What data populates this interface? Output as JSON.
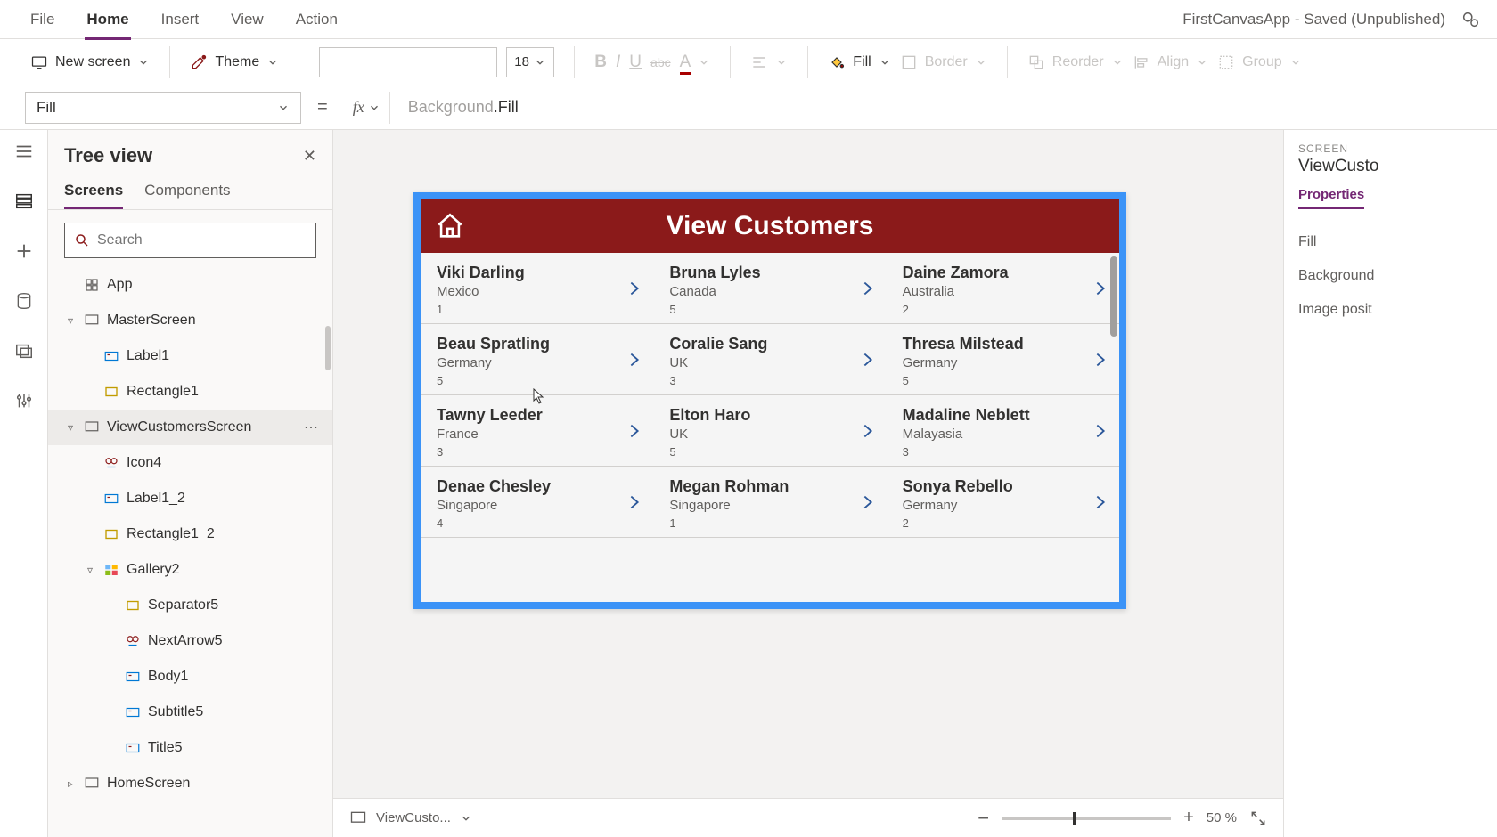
{
  "menubar": {
    "items": [
      "File",
      "Home",
      "Insert",
      "View",
      "Action"
    ],
    "active_index": 1,
    "app_title": "FirstCanvasApp - Saved (Unpublished)"
  },
  "toolbar": {
    "new_screen": "New screen",
    "theme": "Theme",
    "font_size": "18",
    "fill": "Fill",
    "border": "Border",
    "reorder": "Reorder",
    "align": "Align",
    "group": "Group"
  },
  "formula": {
    "property": "Fill",
    "expr_obj": "Background",
    "expr_rest": ".Fill"
  },
  "tree": {
    "title": "Tree view",
    "tabs": [
      "Screens",
      "Components"
    ],
    "active_tab": 0,
    "search_placeholder": "Search",
    "nodes": [
      {
        "label": "App",
        "icon": "app",
        "indent": 0,
        "exp": ""
      },
      {
        "label": "MasterScreen",
        "icon": "screen",
        "indent": 0,
        "exp": "v"
      },
      {
        "label": "Label1",
        "icon": "label",
        "indent": 1,
        "exp": ""
      },
      {
        "label": "Rectangle1",
        "icon": "rect",
        "indent": 1,
        "exp": ""
      },
      {
        "label": "ViewCustomersScreen",
        "icon": "screen",
        "indent": 0,
        "exp": "v",
        "selected": true,
        "more": true
      },
      {
        "label": "Icon4",
        "icon": "iconctl",
        "indent": 1,
        "exp": ""
      },
      {
        "label": "Label1_2",
        "icon": "label",
        "indent": 1,
        "exp": ""
      },
      {
        "label": "Rectangle1_2",
        "icon": "rect",
        "indent": 1,
        "exp": ""
      },
      {
        "label": "Gallery2",
        "icon": "gallery",
        "indent": 1,
        "exp": "v"
      },
      {
        "label": "Separator5",
        "icon": "rect",
        "indent": 2,
        "exp": ""
      },
      {
        "label": "NextArrow5",
        "icon": "iconctl",
        "indent": 2,
        "exp": ""
      },
      {
        "label": "Body1",
        "icon": "label",
        "indent": 2,
        "exp": ""
      },
      {
        "label": "Subtitle5",
        "icon": "label",
        "indent": 2,
        "exp": ""
      },
      {
        "label": "Title5",
        "icon": "label",
        "indent": 2,
        "exp": ""
      },
      {
        "label": "HomeScreen",
        "icon": "screen",
        "indent": 0,
        "exp": ">"
      }
    ]
  },
  "canvas": {
    "header_title": "View Customers",
    "customers": [
      {
        "name": "Viki Darling",
        "country": "Mexico",
        "num": "1"
      },
      {
        "name": "Bruna Lyles",
        "country": "Canada",
        "num": "5"
      },
      {
        "name": "Daine Zamora",
        "country": "Australia",
        "num": "2"
      },
      {
        "name": "Beau Spratling",
        "country": "Germany",
        "num": "5"
      },
      {
        "name": "Coralie Sang",
        "country": "UK",
        "num": "3"
      },
      {
        "name": "Thresa Milstead",
        "country": "Germany",
        "num": "5"
      },
      {
        "name": "Tawny Leeder",
        "country": "France",
        "num": "3"
      },
      {
        "name": "Elton Haro",
        "country": "UK",
        "num": "5"
      },
      {
        "name": "Madaline Neblett",
        "country": "Malayasia",
        "num": "3"
      },
      {
        "name": "Denae Chesley",
        "country": "Singapore",
        "num": "4"
      },
      {
        "name": "Megan Rohman",
        "country": "Singapore",
        "num": "1"
      },
      {
        "name": "Sonya Rebello",
        "country": "Germany",
        "num": "2"
      }
    ]
  },
  "status": {
    "screen_label": "ViewCusto...",
    "zoom": "50",
    "zoom_pct": "%"
  },
  "props": {
    "label": "SCREEN",
    "name": "ViewCusto",
    "tab": "Properties",
    "rows": [
      "Fill",
      "Background",
      "Image posit"
    ]
  }
}
